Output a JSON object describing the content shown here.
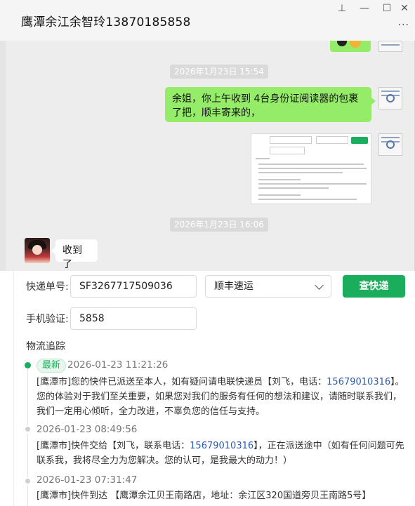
{
  "window": {
    "title": "鹰潭余江余智玲13870185858",
    "pin_glyph": "⊥",
    "minimize_glyph": "—",
    "maximize_glyph": "☐",
    "close_glyph": "✕",
    "more_glyph": "···"
  },
  "chat": {
    "timestamp_1": "2026年1月23日 15:54",
    "message_out": "余姐，你上午收到 4台身份证阅读器的包裹了把，顺丰寄来的，",
    "timestamp_2": "2026年1月23日 16:06",
    "message_in": "收到了"
  },
  "tracking": {
    "label_number": "快递单号:",
    "tracking_number": "SF3267717509036",
    "carrier": "顺丰速运",
    "query_button": "查快递",
    "label_phone": "手机验证:",
    "phone_code": "5858",
    "section_title": "物流追踪",
    "latest_badge": "最新",
    "events": [
      {
        "time": "2026-01-23 11:21:26",
        "text_a": "[鹰潭市]您的快件已派送至本人，如有疑问请电联快递员【刘飞，电话：",
        "phone": "15679010316",
        "text_b": "】。您的体验对于我们至关重要，如果您对我们的服务有任何的想法和建议，请随时联系我们，我们一定用心倾听，全力改进，不辜负您的信任与支持。"
      },
      {
        "time": "2026-01-23 08:49:56",
        "text_a": "[鹰潭市]快件交给【刘飞，联系电话：",
        "phone": "15679010316",
        "text_b": "】，正在派送途中（如有任何问题可先联系我，我将尽全力为您解决。您的认可，是我最大的动力！）"
      },
      {
        "time": "2026-01-23 07:31:47",
        "text_a": "[鹰潭市]快件到达 【鹰潭余江贝王南路店，地址：余江区320国道旁贝王南路5号】",
        "phone": "",
        "text_b": ""
      }
    ]
  },
  "colors": {
    "accent_green": "#1aad5b",
    "bubble_green": "#95ec69",
    "phone_link": "#2e5dab"
  }
}
